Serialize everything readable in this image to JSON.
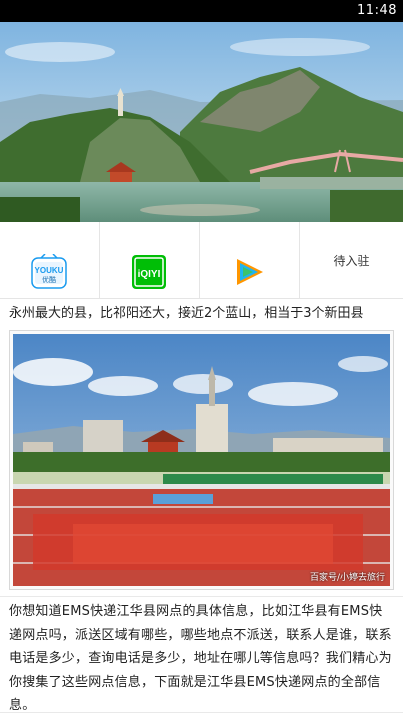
{
  "status_bar": {
    "time": "11:48"
  },
  "apps": [
    {
      "name": "youku",
      "label": "YOUKU",
      "sub_label": "优酷",
      "color": "#1a9bef"
    },
    {
      "name": "iqiyi",
      "label": "iQIYI",
      "color": "#00be06"
    },
    {
      "name": "tencent-video",
      "color": "#ff9600"
    },
    {
      "name": "pending",
      "label": "待入驻"
    }
  ],
  "headline": "永州最大的县，比祁阳还大，接近2个蓝山，相当于3个新田县",
  "photo": {
    "watermark": "百家号/小婷去旅行"
  },
  "body_text": "你想知道EMS快递江华县网点的具体信息，比如江华县有EMS快递网点吗，派送区域有哪些，哪些地点不派送，联系人是谁，联系电话是多少，查询电话是多少，地址在哪儿等信息吗？我们精心为你搜集了这些网点信息，下面就是江华县EMS快递网点的全部信息。"
}
